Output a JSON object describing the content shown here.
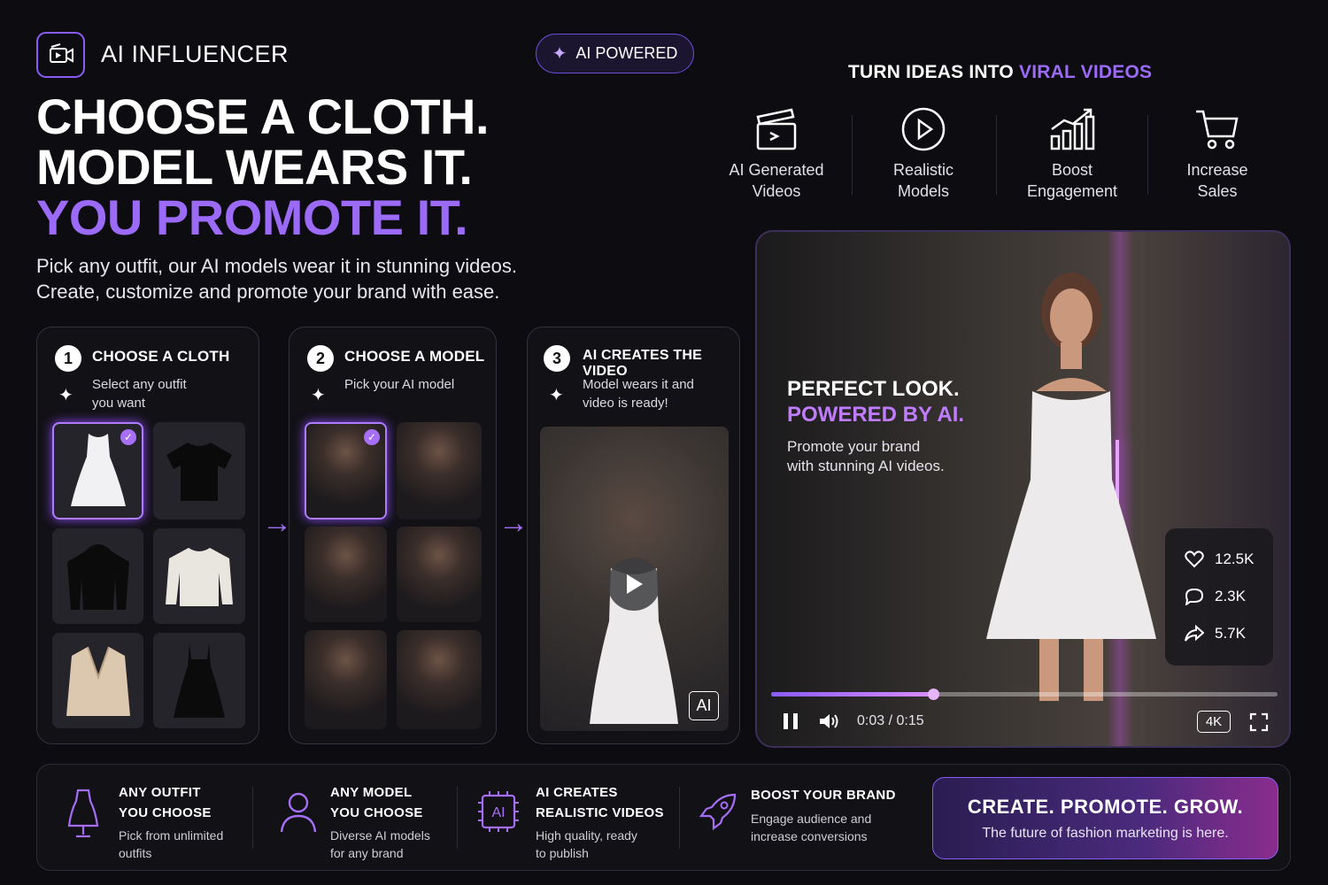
{
  "brand": {
    "name": "AI INFLUENCER",
    "badge": "AI POWERED"
  },
  "hero": {
    "line1": "CHOOSE A CLOTH.",
    "line2": "MODEL WEARS IT.",
    "line3": "YOU PROMOTE IT.",
    "sub1": "Pick any outfit, our AI models wear it in stunning videos.",
    "sub2": "Create, customize and promote your brand with ease."
  },
  "viral": {
    "title_a": "TURN IDEAS INTO ",
    "title_b": "VIRAL VIDEOS",
    "features": [
      {
        "l1": "AI Generated",
        "l2": "Videos",
        "icon": "clapperboard-icon"
      },
      {
        "l1": "Realistic",
        "l2": "Models",
        "icon": "play-circle-icon"
      },
      {
        "l1": "Boost",
        "l2": "Engagement",
        "icon": "chart-growth-icon"
      },
      {
        "l1": "Increase",
        "l2": "Sales",
        "icon": "cart-icon"
      }
    ]
  },
  "steps": [
    {
      "num": "1",
      "title": "CHOOSE A CLOTH",
      "d1": "Select any outfit",
      "d2": "you want"
    },
    {
      "num": "2",
      "title": "CHOOSE A MODEL",
      "d1": "Pick your AI model",
      "d2": ""
    },
    {
      "num": "3",
      "title": "AI CREATES THE VIDEO",
      "d1": "Model wears it and",
      "d2": "video is ready!"
    }
  ],
  "ai_badge": "AI",
  "video": {
    "h1": "PERFECT LOOK.",
    "h2": "POWERED BY AI.",
    "d1": "Promote your brand",
    "d2": "with stunning AI videos.",
    "likes": "12.5K",
    "comments": "2.3K",
    "shares": "5.7K",
    "time": "0:03 / 0:15",
    "quality": "4K",
    "progress": 0.32
  },
  "bottom": [
    {
      "t1": "ANY OUTFIT",
      "t2": "YOU CHOOSE",
      "d1": "Pick from unlimited",
      "d2": "outfits"
    },
    {
      "t1": "ANY MODEL",
      "t2": "YOU CHOOSE",
      "d1": "Diverse AI models",
      "d2": "for any brand"
    },
    {
      "t1": "AI CREATES",
      "t2": "REALISTIC VIDEOS",
      "d1": "High quality, ready",
      "d2": "to publish"
    },
    {
      "t1": "BOOST YOUR BRAND",
      "t2": "",
      "d1": "Engage audience and",
      "d2": "increase conversions"
    }
  ],
  "cta": {
    "title": "CREATE. PROMOTE. GROW.",
    "sub": "The future of fashion marketing is here."
  },
  "colors": {
    "accent": "#9b6bf7",
    "background": "#0d0c10"
  }
}
